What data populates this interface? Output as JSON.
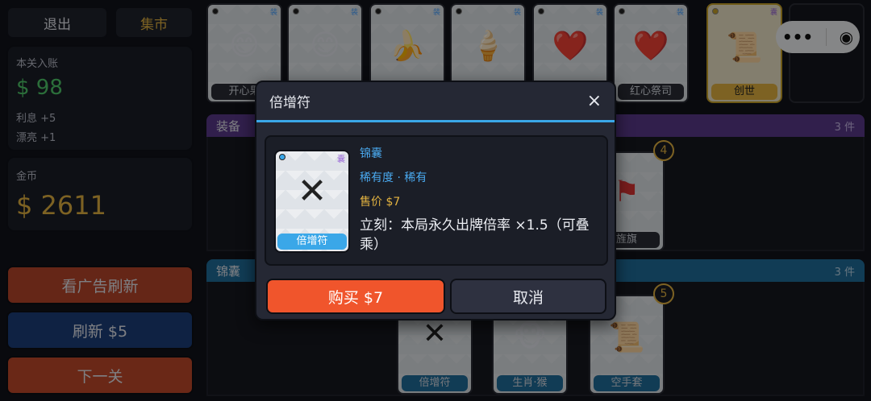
{
  "left": {
    "exit_label": "退出",
    "market_label": "集市",
    "income": {
      "title": "本关入账",
      "amount": "$ 98",
      "interest": "利息 +5",
      "pretty": "漂亮 +1"
    },
    "gold": {
      "title": "金币",
      "amount": "$ 2611"
    },
    "ad_refresh_label": "看广告刷新",
    "refresh_label": "刷新 $5",
    "next_label": "下一关"
  },
  "top_cards": [
    {
      "emoji": "😄",
      "caption": "开心果"
    },
    {
      "emoji": "😊",
      "caption": ""
    },
    {
      "emoji": "🍌",
      "caption": ""
    },
    {
      "emoji": "🍦",
      "caption": ""
    },
    {
      "emoji": "❤️",
      "caption": ""
    },
    {
      "emoji": "❤️",
      "caption": "红心祭司"
    }
  ],
  "top_tag": "装",
  "special_card": {
    "emoji": "📜",
    "caption": "创世",
    "tag": "囊"
  },
  "sections": {
    "equip": {
      "label": "装备",
      "count": "3 件"
    },
    "bag": {
      "label": "锦囊",
      "count": "3 件"
    }
  },
  "equip_badge": "4",
  "equip_card_caption": "旌旗",
  "bag_badge": "5",
  "bag_cards": [
    {
      "emoji": "✕",
      "caption": "倍增符"
    },
    {
      "emoji": "🐵",
      "caption": "生肖·猴"
    },
    {
      "emoji": "📜",
      "caption": "空手套"
    }
  ],
  "modal": {
    "title": "倍增符",
    "close_label": "×",
    "card_caption": "倍增符",
    "card_tag": "囊",
    "card_glyph": "✕",
    "type": "锦囊",
    "rarity": "稀有度 · 稀有",
    "price": "售价 $7",
    "desc": "立刻：本局永久出牌倍率 ×1.5（可叠乘）",
    "buy_label": "购买 $7",
    "cancel_label": "取消"
  },
  "colors": {
    "equip_bar": "#5a3a8a",
    "bag_bar": "#1f6e9c",
    "buy": "#f0552c",
    "refresh": "#1c3e7a",
    "ad": "#b8452a",
    "next": "#c24a2a"
  }
}
